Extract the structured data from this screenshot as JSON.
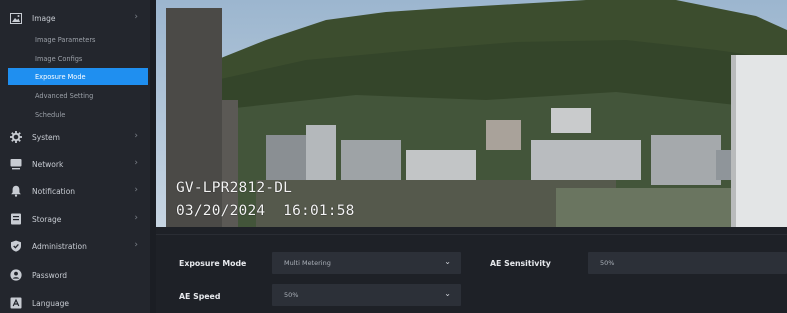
{
  "sidebar": {
    "image": {
      "label": "Image",
      "icon": "image-icon"
    },
    "image_sub": [
      {
        "label": "Image Parameters"
      },
      {
        "label": "Image Configs"
      },
      {
        "label": "Exposure Mode",
        "active": true
      },
      {
        "label": "Advanced Setting"
      },
      {
        "label": "Schedule"
      }
    ],
    "items": [
      {
        "label": "System",
        "icon": "gear-icon"
      },
      {
        "label": "Network",
        "icon": "monitor-icon"
      },
      {
        "label": "Notification",
        "icon": "bell-icon"
      },
      {
        "label": "Storage",
        "icon": "storage-icon"
      },
      {
        "label": "Administration",
        "icon": "shield-icon"
      },
      {
        "label": "Password",
        "icon": "user-icon"
      },
      {
        "label": "Language",
        "icon": "language-icon"
      }
    ]
  },
  "video": {
    "camera_name": "GV-LPR2812-DL",
    "timestamp": "03/20/2024  16:01:58"
  },
  "settings": {
    "exposure_mode": {
      "label": "Exposure Mode",
      "value": "Multi Metering"
    },
    "ae_sensitivity": {
      "label": "AE Sensitivity",
      "value": "50%"
    },
    "ae_speed": {
      "label": "AE Speed",
      "value": "50%"
    }
  },
  "colors": {
    "accent": "#1f8ff0",
    "sidebar_bg": "#23262d",
    "field_bg": "#2c3038"
  }
}
